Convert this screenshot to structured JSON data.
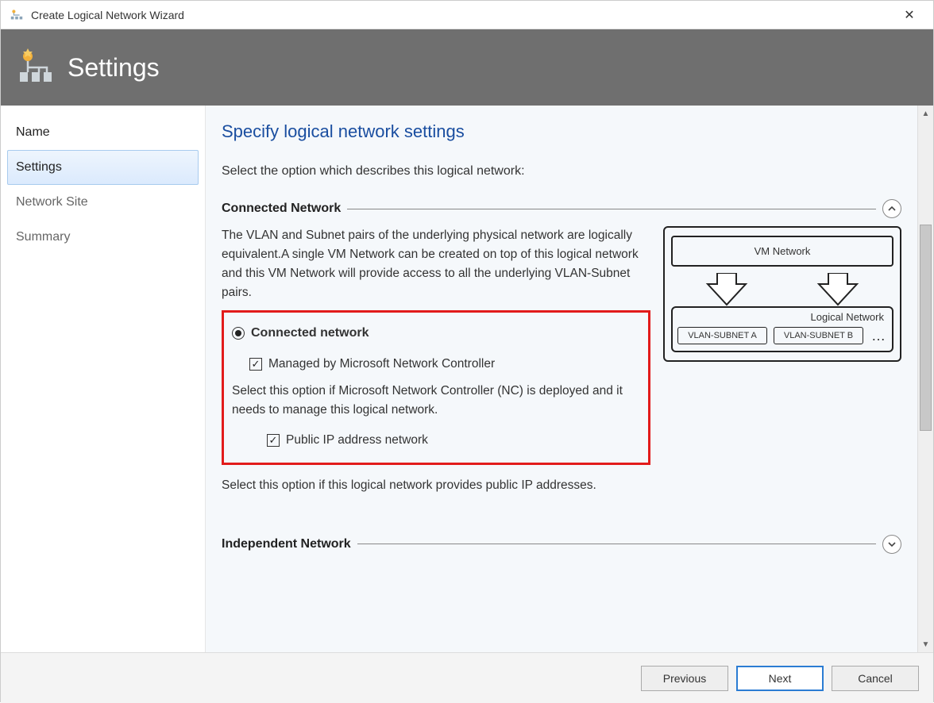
{
  "window": {
    "title": "Create Logical Network Wizard"
  },
  "header": {
    "title": "Settings"
  },
  "sidebar": {
    "items": [
      {
        "label": "Name"
      },
      {
        "label": "Settings"
      },
      {
        "label": "Network Site"
      },
      {
        "label": "Summary"
      }
    ]
  },
  "page": {
    "heading": "Specify logical network settings",
    "instruction": "Select the option which describes this logical network:",
    "section1": {
      "title": "Connected Network",
      "description": "The VLAN and Subnet pairs of the underlying physical network are logically equivalent.A single VM Network can be created on top of this logical network and this VM Network will provide access to all the underlying VLAN-Subnet pairs.",
      "radio_label": "Connected network",
      "checkbox1_label": "Managed by Microsoft Network Controller",
      "checkbox1_desc": "Select this option if Microsoft Network Controller (NC) is deployed and it needs to manage this logical network.",
      "checkbox2_label": "Public IP address network",
      "checkbox2_desc": "Select this option if this logical network provides public IP addresses."
    },
    "section2": {
      "title": "Independent Network"
    },
    "diagram": {
      "vmnet": "VM Network",
      "logical": "Logical  Network",
      "vlan_a": "VLAN-SUBNET A",
      "vlan_b": "VLAN-SUBNET B",
      "more": "…"
    }
  },
  "footer": {
    "previous": "Previous",
    "next": "Next",
    "cancel": "Cancel"
  }
}
